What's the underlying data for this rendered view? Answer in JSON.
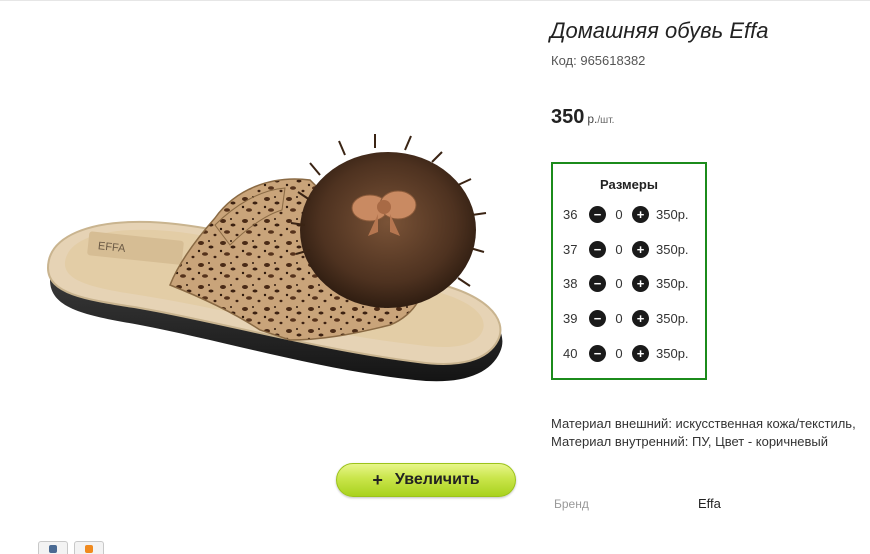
{
  "product": {
    "title": "Домашняя обувь Effa",
    "code_label": "Код:",
    "code_value": "965618382",
    "price_value": "350",
    "price_currency": "р.",
    "price_per": "/шт.",
    "zoom_button": {
      "icon": "+",
      "label": "Увеличить"
    },
    "logo_text": "EFFA"
  },
  "sizes": {
    "title": "Размеры",
    "rows": [
      {
        "size": "36",
        "qty": "0",
        "price": "350р."
      },
      {
        "size": "37",
        "qty": "0",
        "price": "350р."
      },
      {
        "size": "38",
        "qty": "0",
        "price": "350р."
      },
      {
        "size": "39",
        "qty": "0",
        "price": "350р."
      },
      {
        "size": "40",
        "qty": "0",
        "price": "350р."
      }
    ],
    "minus_icon": "−",
    "plus_icon": "+"
  },
  "description": "Материал внешний: искусственная кожа/текстиль, Материал внутренний: ПУ, Цвет - коричневый",
  "brand": {
    "label": "Бренд",
    "value": "Effa"
  },
  "colors": {
    "sizes_border": "#1b8b1b",
    "zoom_button": "#b8db2e",
    "vk": "#4a6a93",
    "ok": "#f08a1e"
  }
}
